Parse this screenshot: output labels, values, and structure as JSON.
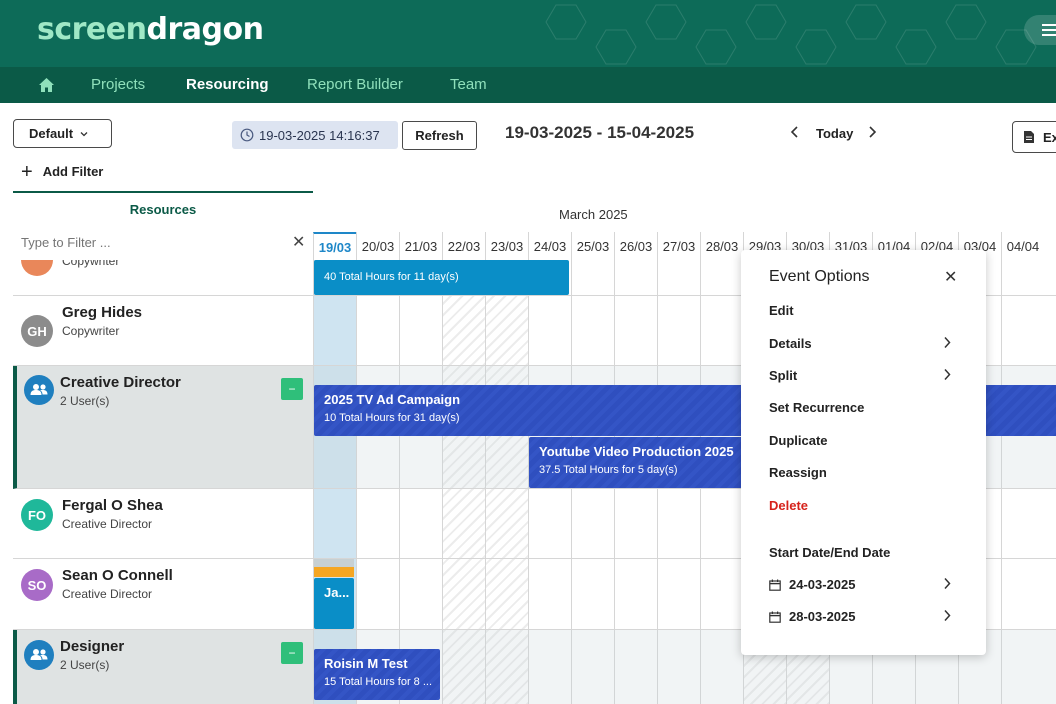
{
  "brand": {
    "logo_part1": "screen",
    "logo_part2": "dragon"
  },
  "nav": {
    "items": [
      "Projects",
      "Resourcing",
      "Report Builder",
      "Team"
    ],
    "active": "Resourcing"
  },
  "toolbar": {
    "view_label": "Default",
    "timestamp": "19-03-2025 14:16:37",
    "refresh_label": "Refresh",
    "date_range": "19-03-2025 - 15-04-2025",
    "today_label": "Today",
    "export_label": "Export",
    "add_filter_label": "Add Filter"
  },
  "resources": {
    "title": "Resources",
    "filter_placeholder": "Type to Filter ...",
    "rows": [
      {
        "type": "person",
        "name": "",
        "role": "Copywriter",
        "initials": "",
        "color": "#e9875a"
      },
      {
        "type": "person",
        "name": "Greg Hides",
        "role": "Copywriter",
        "initials": "GH",
        "color": "#8c8c8c"
      },
      {
        "type": "group",
        "name": "Creative Director",
        "role": "2 User(s)",
        "collapse": "−"
      },
      {
        "type": "person",
        "name": "Fergal O Shea",
        "role": "Creative Director",
        "initials": "FO",
        "color": "#1fb89a"
      },
      {
        "type": "person",
        "name": "Sean O Connell",
        "role": "Creative Director",
        "initials": "SO",
        "color": "#a86bc7"
      },
      {
        "type": "group",
        "name": "Designer",
        "role": "2 User(s)",
        "collapse": "−"
      }
    ]
  },
  "calendar": {
    "month": "March 2025",
    "days": [
      "19/03",
      "20/03",
      "21/03",
      "22/03",
      "23/03",
      "24/03",
      "25/03",
      "26/03",
      "27/03",
      "28/03",
      "29/03",
      "30/03",
      "31/03",
      "01/04",
      "02/04",
      "03/04",
      "04/04"
    ],
    "today": "19/03"
  },
  "events": [
    {
      "title": "",
      "subtitle": "40 Total Hours for 11 day(s)"
    },
    {
      "title": "2025 TV Ad Campaign",
      "subtitle": "10 Total Hours for 31 day(s)"
    },
    {
      "title": "Youtube Video Production 2025",
      "subtitle": "37.5 Total Hours for 5 day(s)"
    },
    {
      "title": "Ja...",
      "subtitle": ""
    },
    {
      "title": "Roisin M Test",
      "subtitle": "15 Total Hours for 8 ..."
    }
  ],
  "event_options": {
    "title": "Event Options",
    "items": [
      "Edit",
      "Details",
      "Split",
      "Set Recurrence",
      "Duplicate",
      "Reassign",
      "Delete"
    ],
    "date_section_label": "Start Date/End Date",
    "start_date": "24-03-2025",
    "end_date": "28-03-2025"
  },
  "colors": {
    "brand_green": "#0d6b58",
    "nav_green": "#0b5a47",
    "event_blue": "#0a8ec7",
    "event_navy": "#2f4fbf",
    "danger": "#d6221b",
    "collapse_green": "#2fbf7a"
  }
}
